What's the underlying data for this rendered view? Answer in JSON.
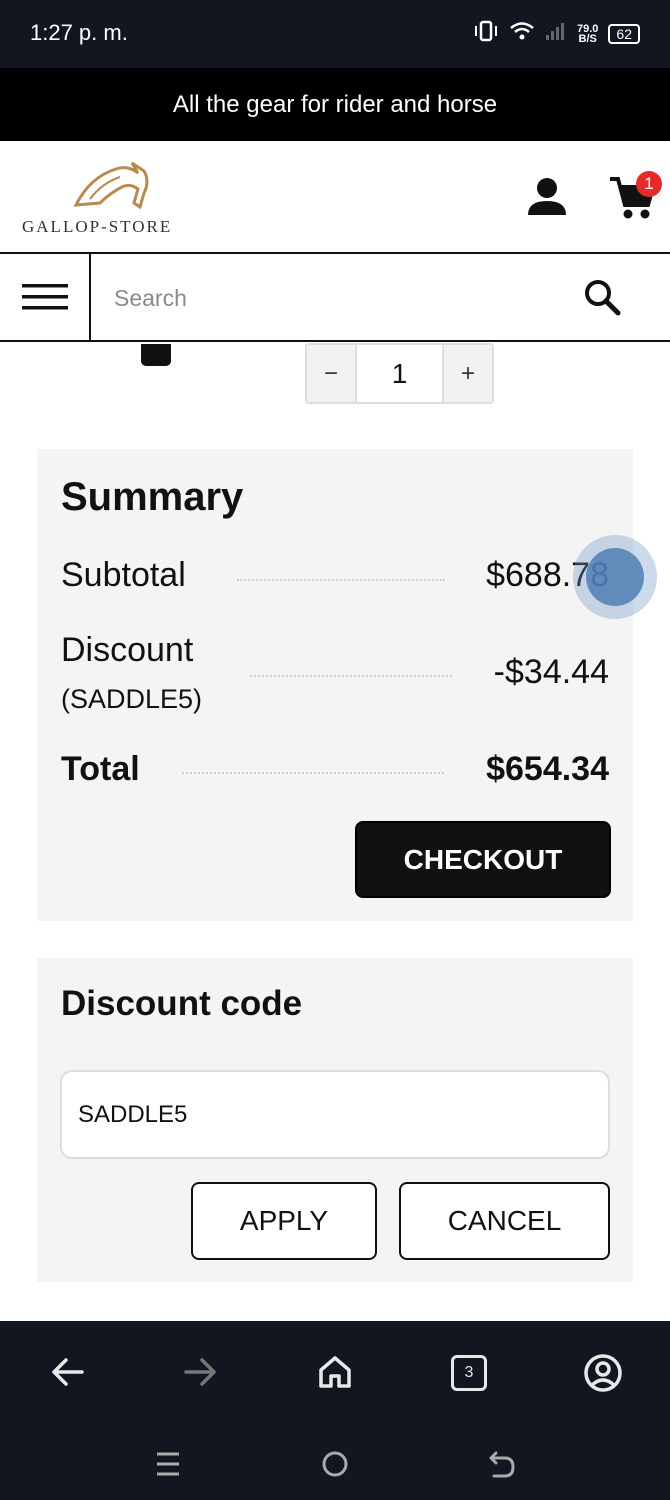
{
  "status": {
    "time": "1:27 p. m.",
    "speed_value": "79.0",
    "speed_unit": "B/S",
    "battery": "62"
  },
  "promo": {
    "text": "All the gear for rider and horse"
  },
  "header": {
    "logo_text": "GALLOP-STORE",
    "cart_count": "1"
  },
  "search": {
    "placeholder": "Search"
  },
  "cart_item": {
    "minus_label": "−",
    "quantity": "1",
    "plus_label": "+"
  },
  "summary": {
    "title": "Summary",
    "subtotal_label": "Subtotal",
    "subtotal_value": "$688.78",
    "discount_label": "Discount",
    "discount_code": "(SADDLE5)",
    "discount_value": "-$34.44",
    "total_label": "Total",
    "total_value": "$654.34",
    "checkout_label": "CHECKOUT"
  },
  "discount_code": {
    "title": "Discount code",
    "input_value": "SADDLE5",
    "apply_label": "APPLY",
    "cancel_label": "CANCEL"
  },
  "browser_nav": {
    "tabs_count": "3"
  },
  "colors": {
    "promo_bg": "#000000",
    "status_bg": "#121620",
    "panel_bg": "#f4f4f4",
    "badge": "#e42b2b",
    "logo_gold": "#b88a4f"
  }
}
